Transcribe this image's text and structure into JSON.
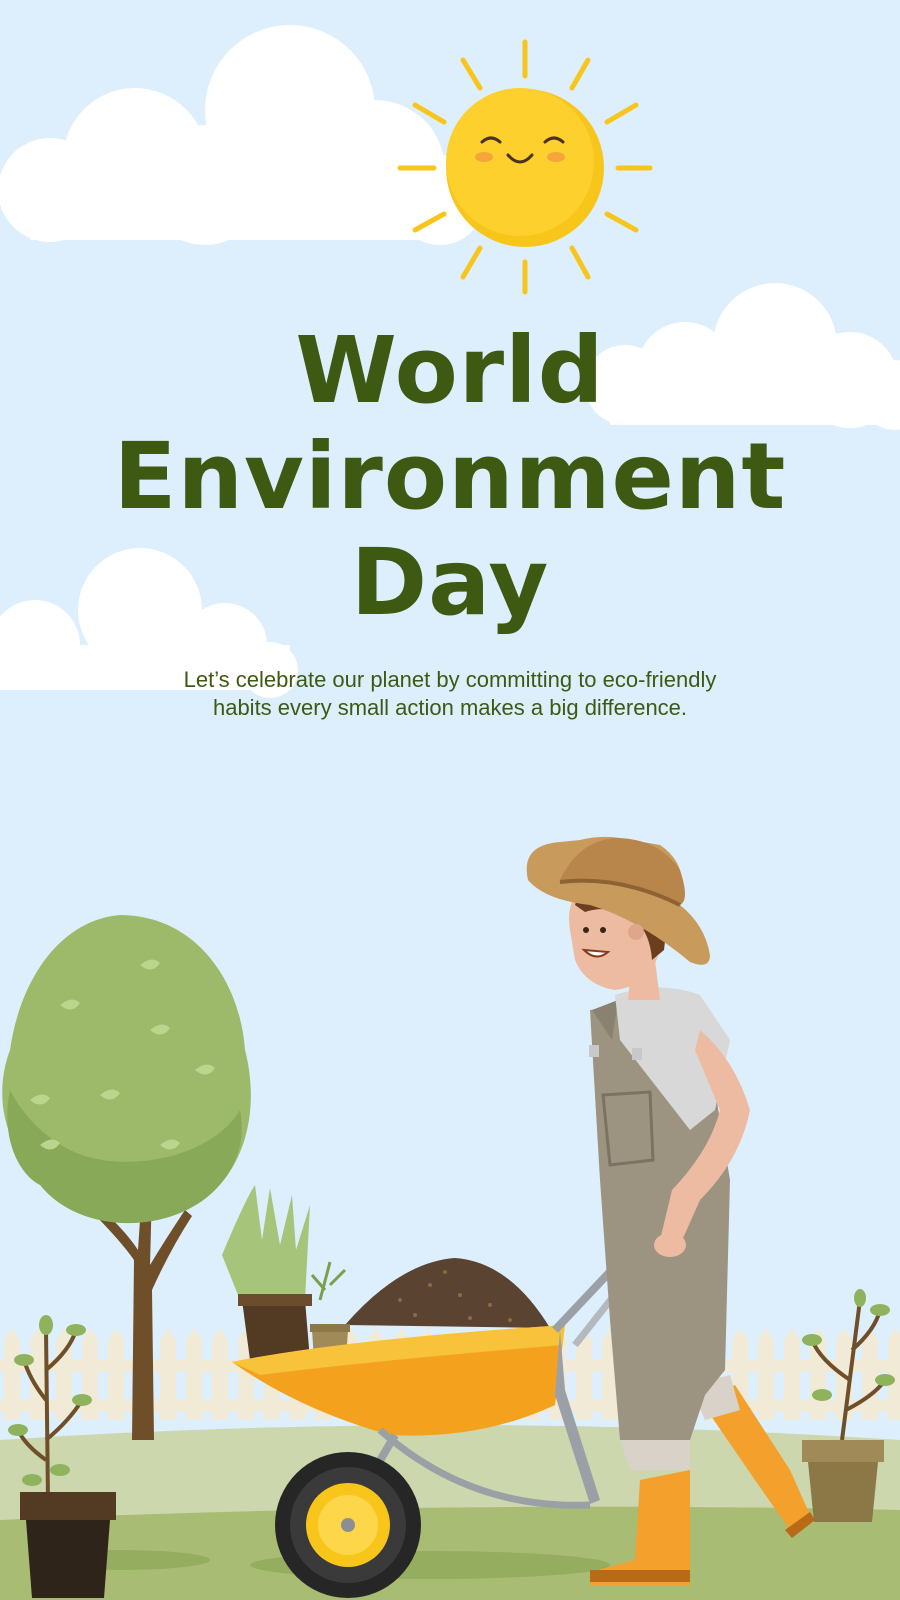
{
  "poster": {
    "title_line1": "World",
    "title_line2": "Environment",
    "title_line3": "Day",
    "subtitle": "Let’s celebrate our planet by committing to eco-friendly habits every small action makes a big difference."
  },
  "colors": {
    "sky": "#ddeffc",
    "title_green": "#3e5a12",
    "sun_yellow": "#f8c51a",
    "grass": "#b8c98e",
    "wheelbarrow": "#f4a21e"
  },
  "icons": [
    "sun-icon",
    "cloud-icon",
    "tree-icon",
    "gardener-icon",
    "wheelbarrow-icon",
    "plant-pot-icon",
    "fence-icon"
  ]
}
